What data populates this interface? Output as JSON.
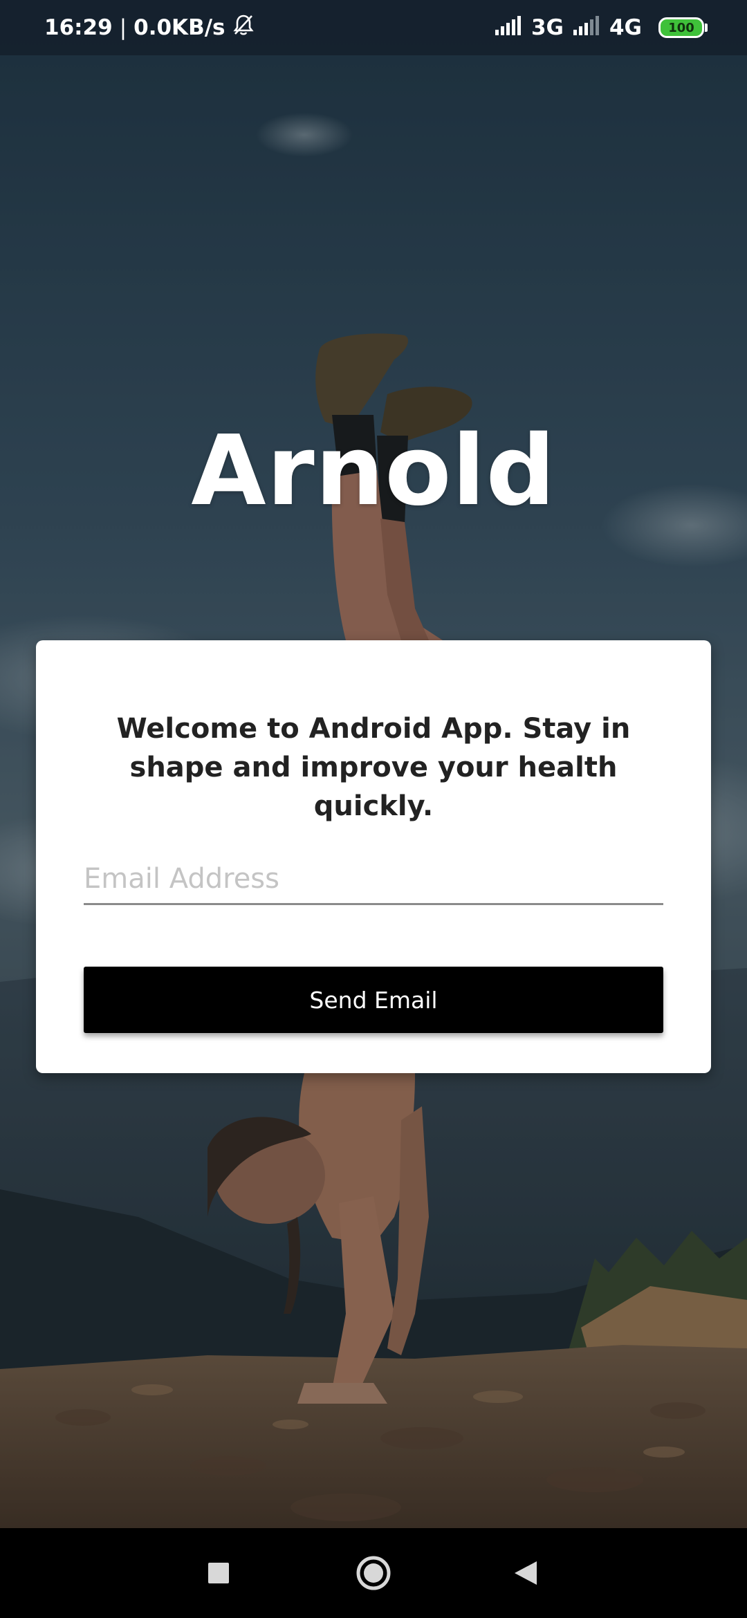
{
  "status_bar": {
    "time": "16:29",
    "separator": "|",
    "speed": "0.0KB/s",
    "icons": [
      "bell-off-icon",
      "signal-icon",
      "signal-icon"
    ],
    "network_1": "3G",
    "network_2": "4G",
    "battery": "100",
    "battery_color": "#3fc13a"
  },
  "app": {
    "title": "Arnold"
  },
  "card": {
    "welcome": "Welcome to Android App. Stay in shape and improve your health quickly.",
    "email_placeholder": "Email Address",
    "email_value": "",
    "button_label": "Send Email",
    "button_color": "#000000"
  },
  "nav_bar": {
    "icons": [
      "recents-icon",
      "home-icon",
      "back-icon"
    ]
  }
}
